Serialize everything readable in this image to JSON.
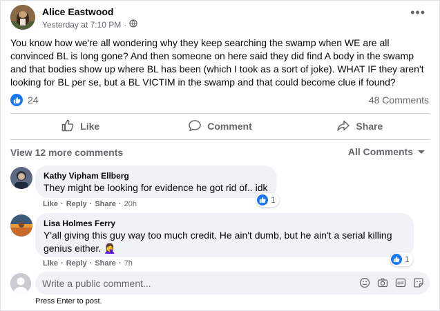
{
  "post": {
    "author": "Alice Eastwood",
    "timestamp": "Yesterday at 7:10 PM",
    "dot": "·",
    "more": "•••",
    "text": "You know how we're all wondering why they keep searching the swamp when WE are all convinced BL is long gone? And then someone on here said they did find A body in the swamp and that bodies show up where BL has been (which I took as a sort of joke). WHAT IF they aren't looking for BL per se, but a BL VICTIM in the swamp and that could become clue if found?",
    "reaction_count": "24",
    "comment_count": "48 Comments"
  },
  "actions": {
    "like": "Like",
    "comment": "Comment",
    "share": "Share"
  },
  "comments_header": {
    "view_more": "View 12 more comments",
    "filter": "All Comments"
  },
  "comments": [
    {
      "name": "Kathy Vipham Ellberg",
      "text": "They might be looking for evidence he got rid of.. idk",
      "like": "Like",
      "reply": "Reply",
      "share": "Share",
      "time": "20h",
      "reactions": "1"
    },
    {
      "name": "Lisa Holmes Ferry",
      "text": "Y'all giving this guy way too much credit. He ain't dumb, but he ain't a serial killing genius either. 🤦‍♀️",
      "like": "Like",
      "reply": "Reply",
      "share": "Share",
      "time": "7h",
      "reactions": "1"
    }
  ],
  "composer": {
    "placeholder": "Write a public comment...",
    "hint": "Press Enter to post."
  },
  "separator": "·",
  "colors": {
    "accent": "#1877f2",
    "secondary_text": "#65676b",
    "bubble": "#f0f2f5"
  },
  "icons": [
    "globe-icon",
    "more-icon",
    "like-icon",
    "comment-icon",
    "share-icon",
    "chevron-down-icon",
    "emoji-icon",
    "camera-icon",
    "gif-icon",
    "sticker-icon"
  ]
}
